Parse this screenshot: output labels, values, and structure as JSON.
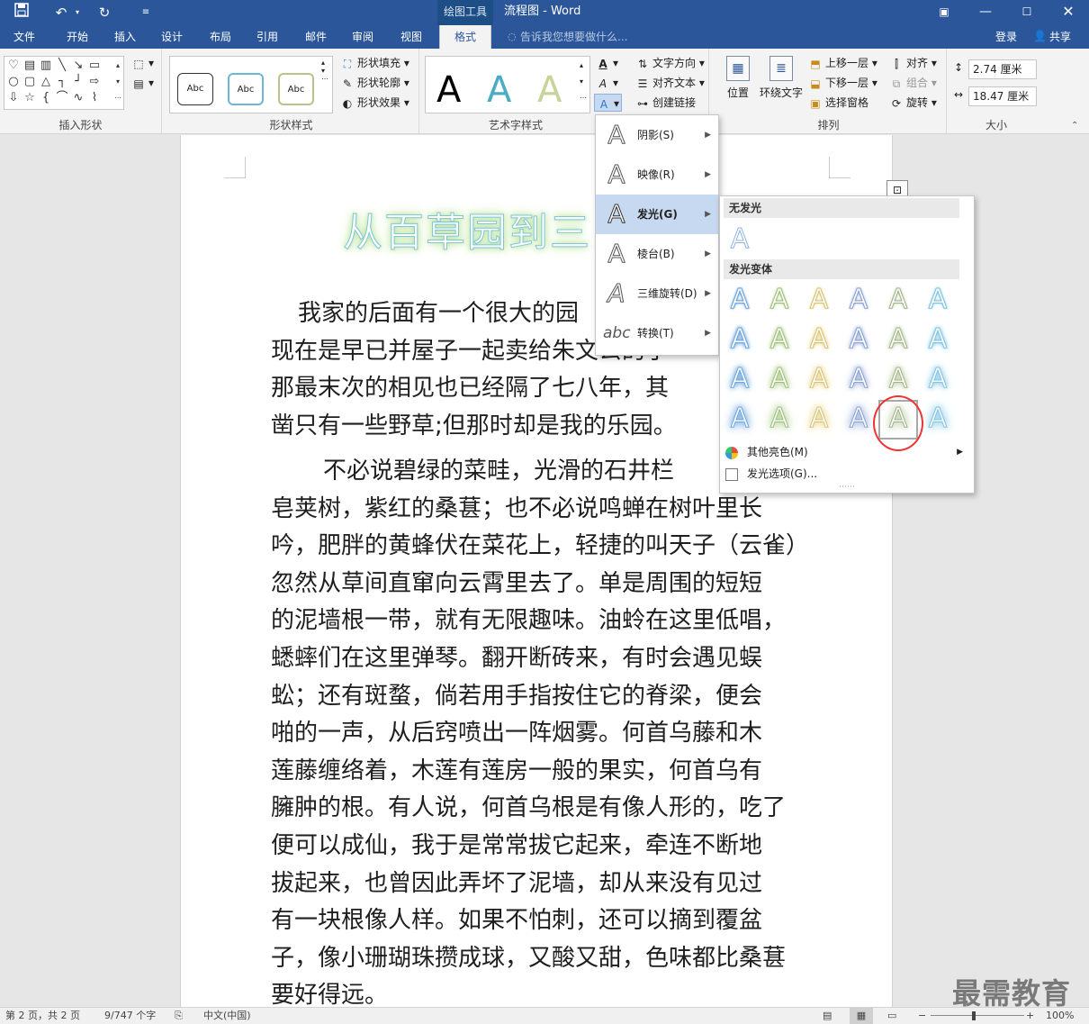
{
  "titlebar": {
    "context_tab": "绘图工具",
    "title": "流程图 - Word",
    "icons": [
      "save-icon",
      "undo-icon",
      "redo-icon",
      "customize-qat-icon"
    ],
    "window_controls": [
      "restore-ribbon-icon",
      "minimize-icon",
      "maximize-icon",
      "close-icon"
    ]
  },
  "tabs": {
    "items": [
      "文件",
      "开始",
      "插入",
      "设计",
      "布局",
      "引用",
      "邮件",
      "审阅",
      "视图",
      "格式"
    ],
    "active": "格式",
    "tell_me": "告诉我您想要做什么...",
    "login": "登录",
    "share": "共享"
  },
  "ribbon": {
    "insert_shapes": {
      "label": "插入形状"
    },
    "shape_styles": {
      "label": "形状样式",
      "sample": "Abc",
      "fill": "形状填充",
      "outline": "形状轮廓",
      "effects": "形状效果"
    },
    "wordart_styles": {
      "label": "艺术字样式",
      "sample": "A"
    },
    "text": {
      "direction": "文字方向",
      "align": "对齐文本",
      "link": "创建链接"
    },
    "arrange": {
      "label": "排列",
      "position": "位置",
      "wrap": "环绕文字",
      "bring_forward": "上移一层",
      "send_backward": "下移一层",
      "selection_pane": "选择窗格",
      "align": "对齐",
      "group": "组合",
      "rotate": "旋转"
    },
    "size": {
      "label": "大小",
      "height": "2.74 厘米",
      "width": "18.47 厘米"
    }
  },
  "effects_menu": {
    "items": [
      {
        "label": "阴影(S)"
      },
      {
        "label": "映像(R)"
      },
      {
        "label": "发光(G)"
      },
      {
        "label": "棱台(B)"
      },
      {
        "label": "三维旋转(D)"
      },
      {
        "label": "转换(T)"
      }
    ],
    "highlighted": "发光(G)",
    "transform_sample": "abc"
  },
  "glow_menu": {
    "no_glow_header": "无发光",
    "variants_header": "发光变体",
    "sample": "A",
    "glow_colors": [
      "#5b9bd5",
      "#a5c87a",
      "#e8d27a",
      "#8ea6d6",
      "#b7c79a",
      "#7fc6e8"
    ],
    "selected": {
      "row": 4,
      "col": 5
    },
    "more_colors": "其他亮色(M)",
    "glow_options": "发光选项(G)..."
  },
  "document": {
    "wordart_title": "从百草园到三",
    "paragraph1": [
      "我家的后面有一个很大的园",
      "现在是早已并屋子一起卖给朱文公的子",
      "那最末次的相见也已经隔了七八年，其",
      "凿只有一些野草;但那时却是我的乐园。"
    ],
    "paragraph2": [
      "不必说碧绿的菜畦，光滑的石井栏",
      "皂荚树，紫红的桑葚；也不必说鸣蝉在树叶里长",
      "吟，肥胖的黄蜂伏在菜花上，轻捷的叫天子（云雀）",
      "忽然从草间直窜向云霄里去了。单是周围的短短",
      "的泥墙根一带，就有无限趣味。油蛉在这里低唱，",
      "蟋蟀们在这里弹琴。翻开断砖来，有时会遇见蜈",
      "蚣；还有斑蝥，倘若用手指按住它的脊梁，便会",
      "啪的一声，从后窍喷出一阵烟雾。何首乌藤和木",
      "莲藤缠络着，木莲有莲房一般的果实，何首乌有",
      "臃肿的根。有人说，何首乌根是有像人形的，吃了",
      "便可以成仙，我于是常常拔它起来，牵连不断地",
      "拔起来，也曾因此弄坏了泥墙，却从来没有见过",
      "有一块根像人样。如果不怕刺，还可以摘到覆盆",
      "子，像小珊瑚珠攒成球，又酸又甜，色味都比桑葚",
      "要好得远。"
    ]
  },
  "statusbar": {
    "page": "第 2 页，共 2 页",
    "words": "9/747 个字",
    "language": "中文(中国)",
    "zoom": "100%"
  },
  "watermark": "最需教育",
  "colors": {
    "ribbon_blue": "#2b579a",
    "highlight": "#c6d9f1",
    "circle": "#e33333"
  }
}
